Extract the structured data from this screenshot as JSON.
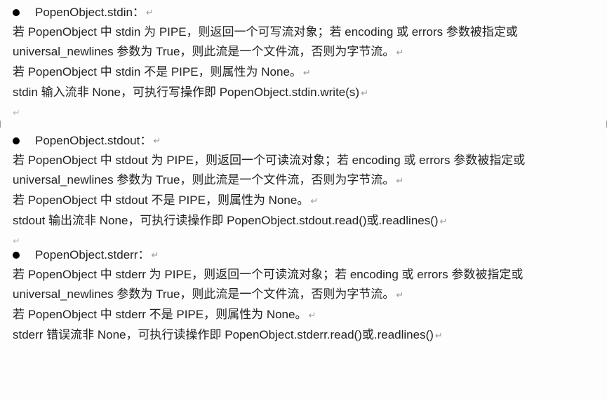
{
  "sections": [
    {
      "bullet_title": "PopenObject.stdin：",
      "lines": [
        "若 PopenObject 中 stdin 为 PIPE，则返回一个可写流对象；若 encoding 或 errors 参数被指定或 universal_newlines 参数为 True，则此流是一个文件流，否则为字节流。",
        "若 PopenObject 中 stdin 不是 PIPE，则属性为 None。",
        "stdin 输入流非 None，可执行写操作即 PopenObject.stdin.write(s)"
      ]
    },
    {
      "bullet_title": "PopenObject.stdout：",
      "lines": [
        "若 PopenObject 中 stdout 为 PIPE，则返回一个可读流对象；若 encoding 或 errors 参数被指定或 universal_newlines 参数为 True，则此流是一个文件流，否则为字节流。",
        "若 PopenObject 中 stdout 不是 PIPE，则属性为 None。",
        "stdout 输出流非 None，可执行读操作即 PopenObject.stdout.read()或.readlines()"
      ]
    },
    {
      "bullet_title": "PopenObject.stderr：",
      "lines": [
        "若 PopenObject 中 stderr 为 PIPE，则返回一个可读流对象；若 encoding 或 errors 参数被指定或 universal_newlines 参数为 True，则此流是一个文件流，否则为字节流。",
        "若 PopenObject 中 stderr 不是 PIPE，则属性为 None。",
        "stderr 错误流非 None，可执行读操作即 PopenObject.stderr.read()或.readlines()"
      ]
    }
  ]
}
